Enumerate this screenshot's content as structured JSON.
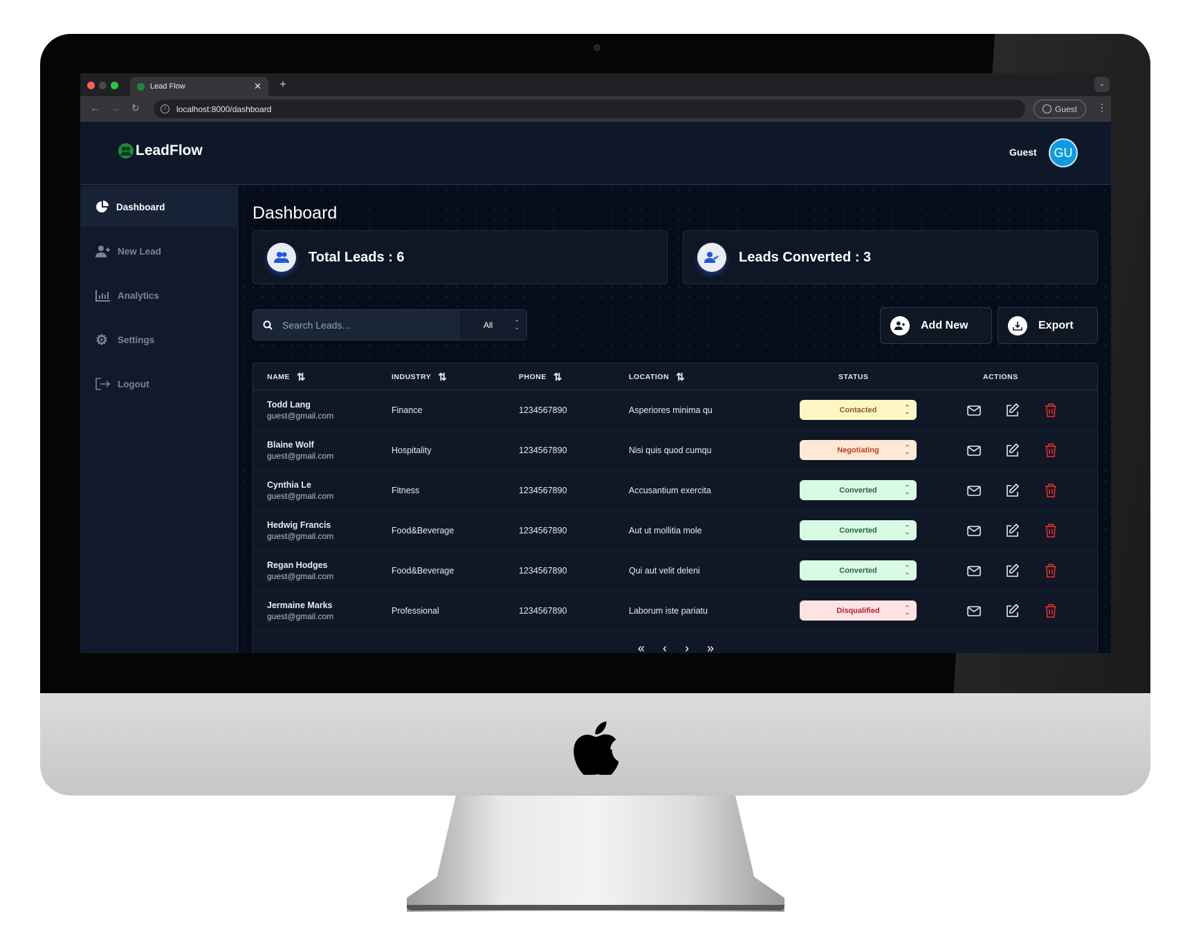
{
  "browser": {
    "tab_title": "Lead Flow",
    "url": "localhost:8000/dashboard",
    "profile": "Guest"
  },
  "app": {
    "brand": "LeadFlow",
    "user_name": "Guest",
    "user_initials": "GU",
    "accent": "#0e9be0"
  },
  "sidebar": {
    "items": [
      {
        "label": "Dashboard",
        "icon": "pie-chart-icon",
        "active": true
      },
      {
        "label": "New Lead",
        "icon": "user-plus-icon"
      },
      {
        "label": "Analytics",
        "icon": "bar-chart-icon"
      },
      {
        "label": "Settings",
        "icon": "gear-icon"
      },
      {
        "label": "Logout",
        "icon": "logout-icon"
      }
    ]
  },
  "main": {
    "title": "Dashboard",
    "stats": [
      {
        "label": "Total Leads : 6",
        "icon": "users-icon"
      },
      {
        "label": "Leads Converted : 3",
        "icon": "user-check-icon"
      }
    ],
    "search": {
      "placeholder": "Search Leads...",
      "filter": "All"
    },
    "buttons": {
      "add": "Add New",
      "export": "Export"
    },
    "table": {
      "headers": {
        "name": "NAME",
        "industry": "INDUSTRY",
        "phone": "PHONE",
        "location": "LOCATION",
        "status": "STATUS",
        "actions": "ACTIONS"
      },
      "rows": [
        {
          "name": "Todd Lang",
          "email": "guest@gmail.com",
          "industry": "Finance",
          "phone": "1234567890",
          "location": "Asperiores minima qu",
          "status": "Contacted"
        },
        {
          "name": "Blaine Wolf",
          "email": "guest@gmail.com",
          "industry": "Hospitality",
          "phone": "1234567890",
          "location": "Nisi quis quod cumqu",
          "status": "Negotiating"
        },
        {
          "name": "Cynthia Le",
          "email": "guest@gmail.com",
          "industry": "Fitness",
          "phone": "1234567890",
          "location": "Accusantium exercita",
          "status": "Converted"
        },
        {
          "name": "Hedwig Francis",
          "email": "guest@gmail.com",
          "industry": "Food&Beverage",
          "phone": "1234567890",
          "location": "Aut ut mollitia mole",
          "status": "Converted"
        },
        {
          "name": "Regan Hodges",
          "email": "guest@gmail.com",
          "industry": "Food&Beverage",
          "phone": "1234567890",
          "location": "Qui aut velit deleni",
          "status": "Converted"
        },
        {
          "name": "Jermaine Marks",
          "email": "guest@gmail.com",
          "industry": "Professional",
          "phone": "1234567890",
          "location": "Laborum iste pariatu",
          "status": "Disqualified"
        }
      ]
    },
    "status_colors": {
      "Contacted": {
        "bg": "#fef6c3",
        "fg": "#8a5a17"
      },
      "Negotiating": {
        "bg": "#ffe8d6",
        "fg": "#b3401f"
      },
      "Converted": {
        "bg": "#d9fbe3",
        "fg": "#23663b"
      },
      "Disqualified": {
        "bg": "#ffe3e3",
        "fg": "#b0202a"
      }
    },
    "pagination": {
      "first": "«",
      "prev": "‹",
      "next": "›",
      "last": "»"
    }
  }
}
